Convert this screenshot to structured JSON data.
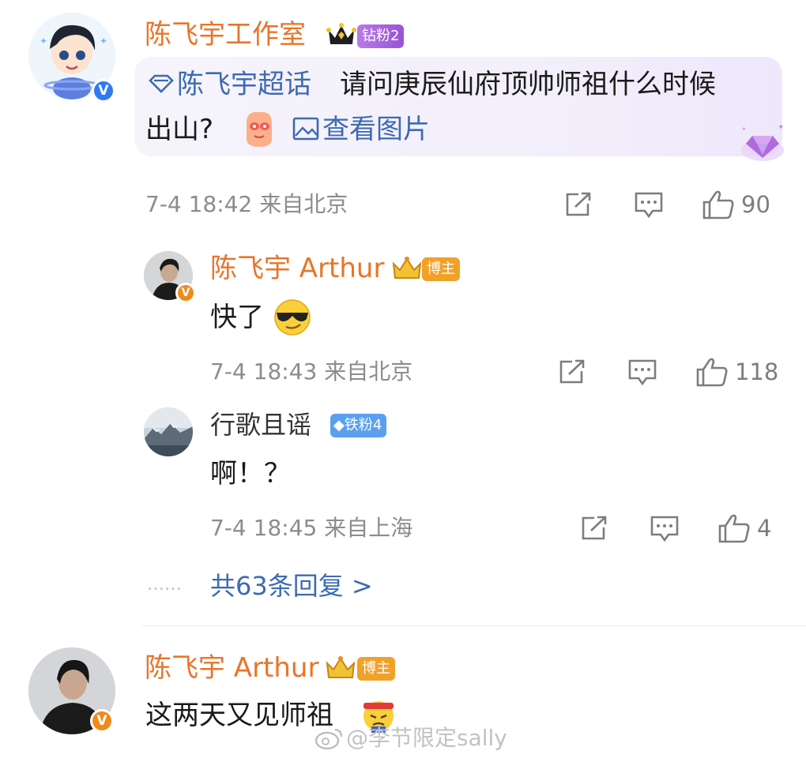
{
  "comment_main": {
    "author": "陈飞宇工作室",
    "fan_badge": "钻粉2",
    "supertopic_label": "陈飞宇超话",
    "text_line1": "请问庚辰仙府顶帅师祖什么时候",
    "text_line2": "出山?",
    "view_image_label": "查看图片",
    "time_location": "7-4 18:42  来自北京",
    "likes": "90"
  },
  "replies": [
    {
      "author": "陈飞宇 Arthur",
      "badge": "博主",
      "text": "快了",
      "time_location": "7-4 18:43  来自北京",
      "likes": "118"
    },
    {
      "author": "行歌且谣",
      "badge": "铁粉4",
      "text": "啊！？",
      "time_location": "7-4 18:45  来自上海",
      "likes": "4"
    }
  ],
  "more_replies": {
    "dots": "……",
    "label": "共63条回复 >"
  },
  "comment_second": {
    "author": "陈飞宇 Arthur",
    "badge": "博主",
    "text": "这两天又见师祖"
  },
  "watermark": {
    "text": "@李节限定sally"
  },
  "colors": {
    "name_orange": "#e8752a",
    "link_blue": "#3d6ab3",
    "verify_blue": "#2d7bf2",
    "verify_orange": "#f08b1a",
    "diamond_badge": "#b06ae0",
    "iron_badge": "#5aa0ee",
    "blogger_badge": "#f0a12a"
  }
}
